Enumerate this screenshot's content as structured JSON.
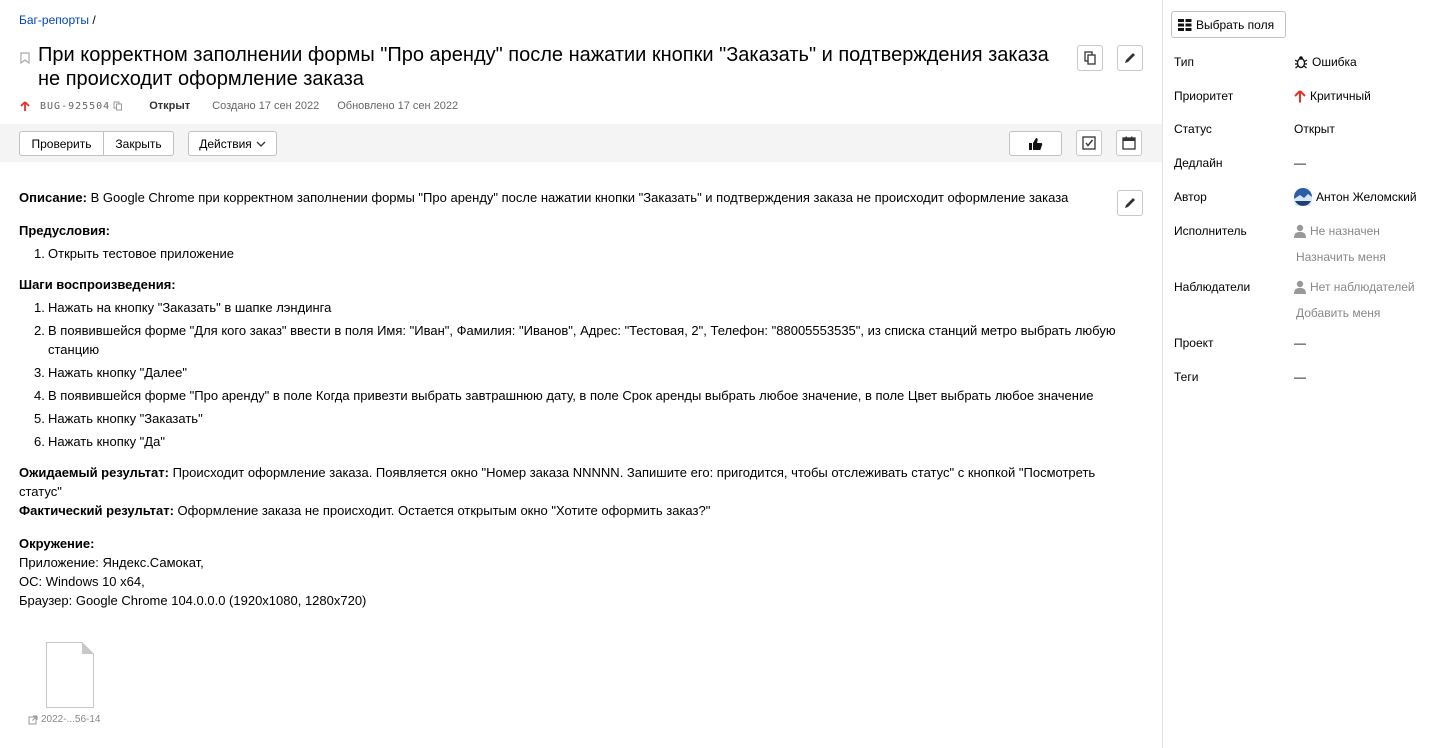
{
  "breadcrumb": {
    "link": "Баг-репорты",
    "separator": "/"
  },
  "issue": {
    "title": "При корректном заполнении формы \"Про аренду\" после нажатии кнопки \"Заказать\" и подтверждения заказа не происходит оформление заказа",
    "key": "BUG-925504",
    "status": "Открыт",
    "created": "Создано 17 сен 2022",
    "updated": "Обновлено 17 сен 2022"
  },
  "toolbar": {
    "check_label": "Проверить",
    "close_label": "Закрыть",
    "actions_label": "Действия"
  },
  "description": {
    "desc_label": "Описание:",
    "desc_text": " В Google Chrome при корректном заполнении формы \"Про аренду\" после нажатии кнопки \"Заказать\" и подтверждения заказа не происходит оформление заказа",
    "preconditions_label": "Предусловия:",
    "preconditions": [
      {
        "num": "1.",
        "text": "Открыть тестовое приложение"
      }
    ],
    "steps_label": "Шаги воспроизведения:",
    "steps": [
      {
        "num": "1.",
        "text": "Нажать на кнопку \"Заказать\" в шапке лэндинга"
      },
      {
        "num": "2.",
        "text": "В появившейся форме \"Для кого заказ\" ввести в поля Имя: \"Иван\", Фамилия: \"Иванов\", Адрес: \"Тестовая, 2\", Телефон: \"88005553535\", из списка станций метро выбрать любую станцию"
      },
      {
        "num": "3.",
        "text": "Нажать кнопку \"Далее\""
      },
      {
        "num": "4.",
        "text": "В появившейся форме \"Про аренду\" в поле Когда привезти выбрать завтрашнюю дату, в поле Срок аренды выбрать любое значение, в поле Цвет выбрать любое значение"
      },
      {
        "num": "5.",
        "text": "Нажать кнопку \"Заказать\""
      },
      {
        "num": "6.",
        "text": "Нажать кнопку \"Да\""
      }
    ],
    "expected_label": "Ожидаемый результат:",
    "expected_text": " Происходит оформление заказа. Появляется окно \"Номер заказа NNNNN. Запишите его: пригодится, чтобы отслеживать статус\" с кнопкой \"Посмотреть статус\"",
    "actual_label": "Фактический результат:",
    "actual_text": " Оформление заказа не происходит. Остается открытым окно \"Хотите оформить заказ?\"",
    "env_label": "Окружение:",
    "env_lines": [
      "Приложение: Яндекс.Самокат,",
      "ОС: Windows 10 x64,",
      "Браузер: Google Chrome 104.0.0.0 (1920x1080, 1280x720)"
    ]
  },
  "attachment": {
    "name": "2022-...56-14"
  },
  "sidebar": {
    "choose_fields": "Выбрать поля",
    "type_label": "Тип",
    "type_value": "Ошибка",
    "priority_label": "Приоритет",
    "priority_value": "Критичный",
    "status_label": "Статус",
    "status_value": "Открыт",
    "deadline_label": "Дедлайн",
    "deadline_value": "—",
    "author_label": "Автор",
    "author_value": "Антон Желомский",
    "assignee_label": "Исполнитель",
    "assignee_value": "Не назначен",
    "assign_me": "Назначить меня",
    "watchers_label": "Наблюдатели",
    "watchers_value": "Нет наблюдателей",
    "add_me": "Добавить меня",
    "project_label": "Проект",
    "project_value": "—",
    "tags_label": "Теги",
    "tags_value": "—"
  },
  "colors": {
    "link": "#0044bb",
    "priority": "#e8302a",
    "toolbar_bg": "#f4f4f4"
  },
  "icons": [
    "bookmark-icon",
    "copy-icon",
    "pencil-icon",
    "thumbs-up-icon",
    "checklist-icon",
    "calendar-icon",
    "bug-icon",
    "arrow-up-icon",
    "user-icon",
    "file-icon",
    "external-link-icon",
    "columns-icon",
    "chevron-down-icon"
  ]
}
